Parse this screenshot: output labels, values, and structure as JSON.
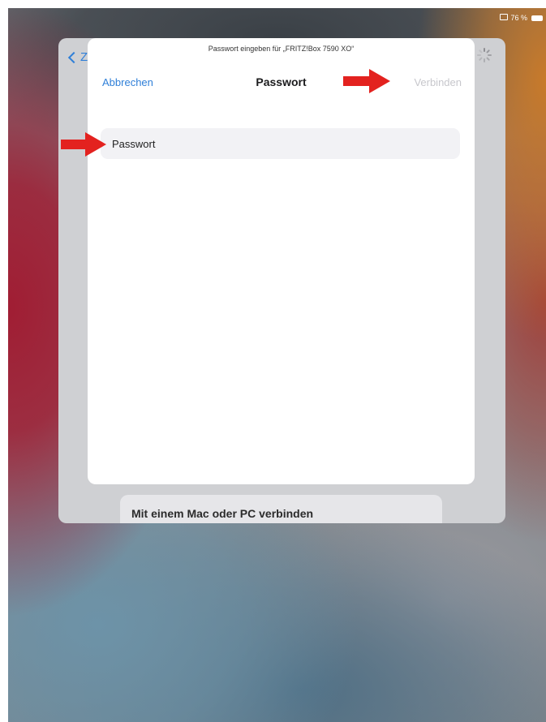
{
  "status_bar": {
    "battery_text": "76 %"
  },
  "background_sheet": {
    "back_label": "Z",
    "mac_card_title": "Mit einem Mac oder PC verbinden"
  },
  "modal": {
    "prompt": "Passwort eingeben für „FRITZ!Box 7590 XO“",
    "cancel_label": "Abbrechen",
    "title": "Passwort",
    "connect_label": "Verbinden",
    "password_placeholder": "Passwort"
  },
  "colors": {
    "accent": "#2f7fd8",
    "disabled": "#c7c7cc",
    "annotation_arrow": "#e3221f"
  },
  "icons": [
    "screen-mirroring-icon",
    "battery-icon",
    "back-chevron-icon",
    "loading-spinner-icon",
    "arrow-annotation-icon"
  ]
}
